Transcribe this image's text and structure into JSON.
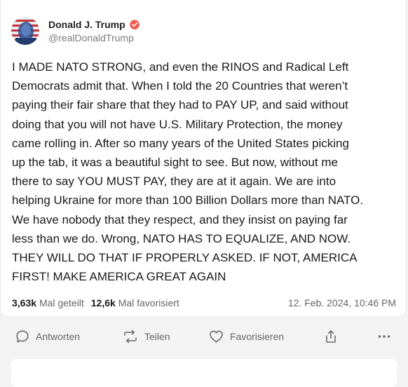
{
  "post": {
    "author_name": "Donald J. Trump",
    "handle": "@realDonaldTrump",
    "text": "I MADE NATO STRONG, and even the RINOS and Radical Left\nDemocrats admit that. When I told the 20 Countries that weren’t\npaying their fair share that they had to PAY UP, and said without\ndoing that you will not have U.S. Military Protection, the money\ncame rolling in. After so many years of the United States picking\nup the tab, it was a beautiful sight to see. But now, without me\nthere to say YOU MUST PAY, they are at it again. We are into\nhelping Ukraine for more than 100 Billion Dollars more than NATO.\nWe have nobody that they respect, and they insist on paying far\nless than we do. Wrong, NATO HAS TO EQUALIZE, AND NOW.\nTHEY WILL DO THAT IF PROPERLY ASKED. IF NOT, AMERICA\nFIRST! MAKE AMERICA GREAT AGAIN",
    "reshare_count": "3,63k",
    "reshare_label": "Mal geteilt",
    "favorite_count": "12,6k",
    "favorite_label": "Mal favorisiert",
    "timestamp": "12. Feb. 2024, 10:46 PM"
  },
  "actions": {
    "reply_label": "Antworten",
    "share_label": "Teilen",
    "favorite_label": "Favorisieren"
  },
  "icons": {
    "avatar": "avatar-image",
    "verified": "verified-badge-icon",
    "reply": "speech-bubble-icon",
    "share": "repost-arrows-icon",
    "favorite": "heart-icon",
    "export": "share-upload-icon",
    "more": "more-dots-icon"
  },
  "colors": {
    "verified_badge": "#f05a4f",
    "icon_gray": "#6b6b6b",
    "background": "#f3f3f3",
    "card": "#ffffff"
  }
}
